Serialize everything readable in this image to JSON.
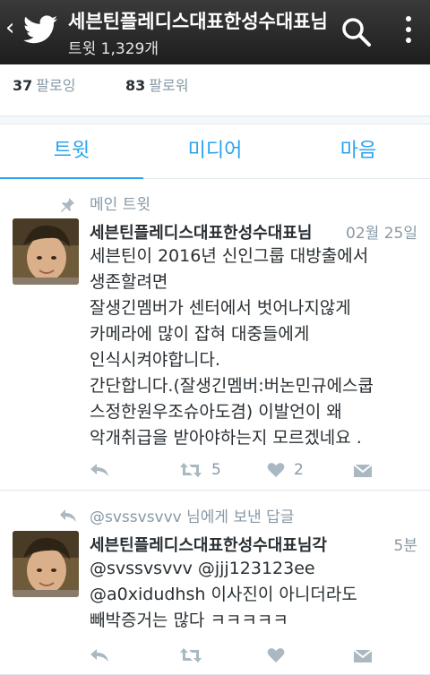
{
  "header": {
    "back_glyph": "‹",
    "title": "세븐틴플레디스대표한성수대표님",
    "subtitle": "트윗 1,329개"
  },
  "stats": {
    "following_count": "37",
    "following_label": "팔로잉",
    "followers_count": "83",
    "followers_label": "팔로워"
  },
  "tabs": [
    {
      "label": "트윗",
      "active": true
    },
    {
      "label": "미디어",
      "active": false
    },
    {
      "label": "마음",
      "active": false
    }
  ],
  "tweets": [
    {
      "context": "메인 트윗",
      "name": "세븐틴플레디스대표한성수대표님",
      "time": "02월 25일",
      "lines": [
        "세븐틴이 2016년 신인그룹 대방출에서",
        "생존할려면",
        "잘생긴멤버가 센터에서 벗어나지않게",
        "카메라에 많이 잡혀 대중들에게",
        "인식시켜야합니다.",
        "간단합니다.(잘생긴멤버:버논민규에스쿱",
        "스정한원우조슈아도겸) 이발언이 왜",
        "악개취급을 받아야하는지 모르겠네요 ."
      ],
      "retweets": "5",
      "likes": "2"
    },
    {
      "context": "@svssvsvvv 님에게 보낸 답글",
      "name": "세븐틴플레디스대표한성수대표님각",
      "time": "5분",
      "lines": [
        "@svssvsvvv @jjj123123ee",
        "@a0xidudhsh 이사진이 아니더라도",
        "빼박증거는 많다 ㅋㅋㅋㅋㅋ"
      ],
      "retweets": "",
      "likes": ""
    }
  ],
  "colors": {
    "accent": "#2aa3ef",
    "muted": "#8899a6",
    "text": "#292f33",
    "header_bg": "#2a2a2a"
  }
}
